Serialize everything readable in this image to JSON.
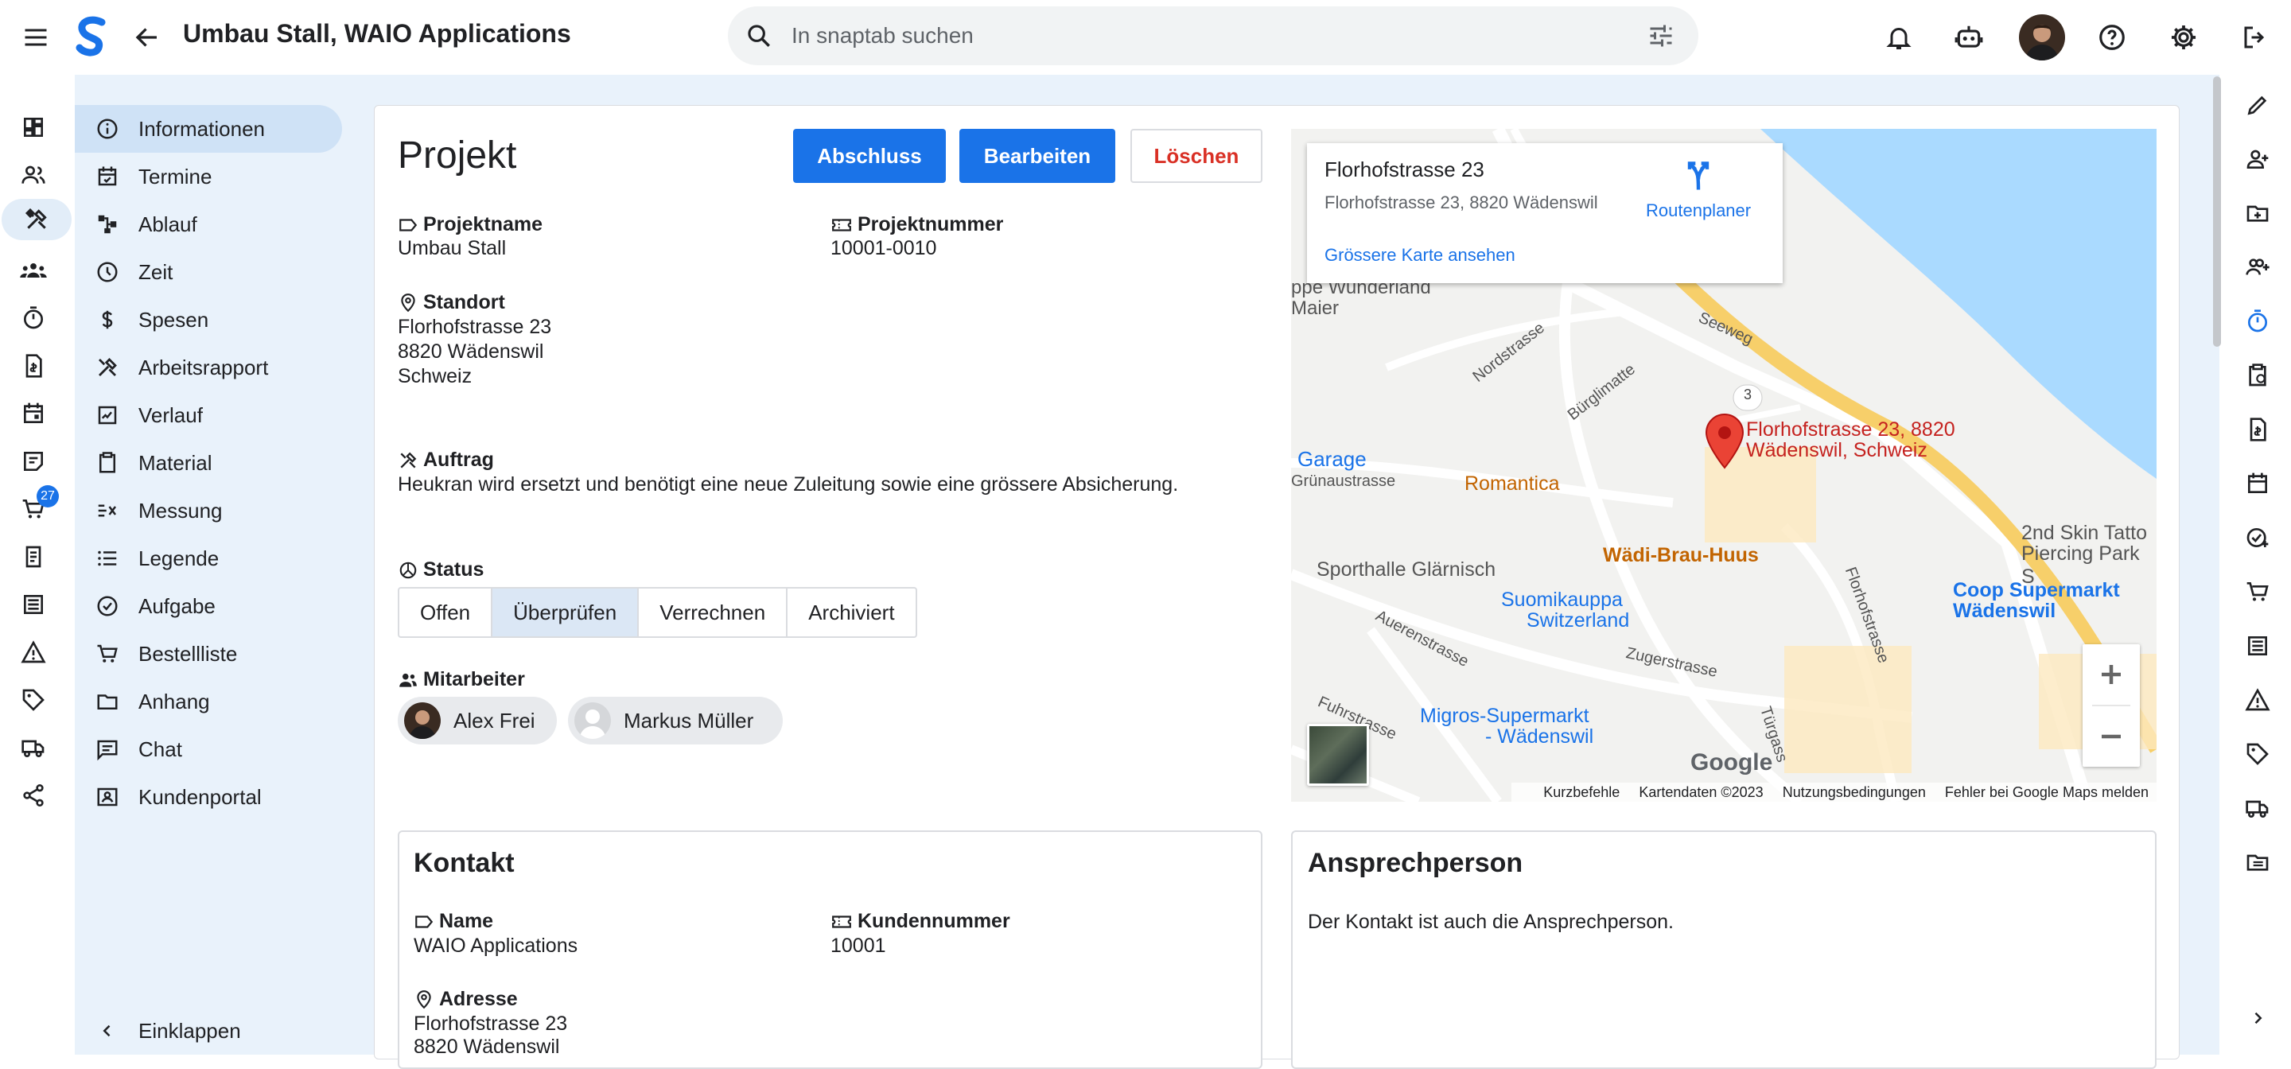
{
  "header": {
    "title": "Umbau Stall, WAIO Applications",
    "search_placeholder": "In snaptab suchen"
  },
  "nav": {
    "items": [
      {
        "label": "Informationen",
        "active": true
      },
      {
        "label": "Termine"
      },
      {
        "label": "Ablauf"
      },
      {
        "label": "Zeit"
      },
      {
        "label": "Spesen"
      },
      {
        "label": "Arbeitsrapport"
      },
      {
        "label": "Verlauf"
      },
      {
        "label": "Material"
      },
      {
        "label": "Messung"
      },
      {
        "label": "Legende"
      },
      {
        "label": "Aufgabe"
      },
      {
        "label": "Bestellliste"
      },
      {
        "label": "Anhang"
      },
      {
        "label": "Chat"
      },
      {
        "label": "Kundenportal"
      }
    ],
    "collapse_label": "Einklappen"
  },
  "rail": {
    "cart_badge": "27"
  },
  "project": {
    "heading": "Projekt",
    "buttons": {
      "close": "Abschluss",
      "edit": "Bearbeiten",
      "delete": "Löschen"
    },
    "name_label": "Projektname",
    "name_value": "Umbau Stall",
    "number_label": "Projektnummer",
    "number_value": "10001-0010",
    "location_label": "Standort",
    "location_lines": [
      "Florhofstrasse 23",
      "8820 Wädenswil",
      "Schweiz"
    ],
    "order_label": "Auftrag",
    "order_value": "Heukran wird ersetzt und benötigt eine neue Zuleitung sowie eine grössere Absicherung.",
    "status_label": "Status",
    "status_options": [
      "Offen",
      "Überprüfen",
      "Verrechnen",
      "Archiviert"
    ],
    "status_selected": "Überprüfen",
    "staff_label": "Mitarbeiter",
    "staff": [
      "Alex Frei",
      "Markus Müller"
    ]
  },
  "map": {
    "info_title": "Florhofstrasse 23",
    "info_address": "Florhofstrasse 23, 8820 Wädenswil",
    "route_label": "Routenplaner",
    "bigger_map": "Grössere Karte ansehen",
    "pin_label_1": "Florhofstrasse 23, 8820",
    "pin_label_2": "Wädenswil, Schweiz",
    "places": {
      "wunderland": "ppe Wunderland",
      "maier": "Maier",
      "garage": "Garage",
      "romantica": "Romantica",
      "sporthalle": "Sporthalle Glärnisch",
      "waedi_brau": "Wädi-Brau-Huus",
      "suomi_1": "Suomikauppa",
      "suomi_2": "Switzerland",
      "migros_1": "Migros-Supermarkt",
      "migros_2": "- Wädenswil",
      "coop_1": "Coop Supermarkt",
      "coop_2": "Wädenswil",
      "tattoo_1": "2nd Skin Tatto",
      "tattoo_2": "Piercing Park S"
    },
    "streets": {
      "seeweg": "Seeweg",
      "nordstrasse": "Nordstrasse",
      "buerglimatte": "Bürglimatte",
      "gruenaustrasse": "Grünaustrasse",
      "florhofstrasse": "Florhofstrasse",
      "auerenstrasse": "Auerenstrasse",
      "zugerstrasse": "Zugerstrasse",
      "fuhrstrasse": "Fuhrstrasse",
      "tuergass": "Türgass",
      "road3": "3"
    },
    "google": "Google",
    "footer": [
      "Kurzbefehle",
      "Kartendaten ©2023",
      "Nutzungsbedingungen",
      "Fehler bei Google Maps melden"
    ]
  },
  "contact": {
    "heading": "Kontakt",
    "name_label": "Name",
    "name_value": "WAIO Applications",
    "number_label": "Kundennummer",
    "number_value": "10001",
    "address_label": "Adresse",
    "address_lines": [
      "Florhofstrasse 23",
      "8820 Wädenswil"
    ]
  },
  "contact_person": {
    "heading": "Ansprechperson",
    "text": "Der Kontakt ist auch die Ansprechperson."
  },
  "colors": {
    "primary": "#1a73e8",
    "danger": "#d93025",
    "nav_bg": "#e9f2fb",
    "nav_active": "#cfe2f6"
  }
}
